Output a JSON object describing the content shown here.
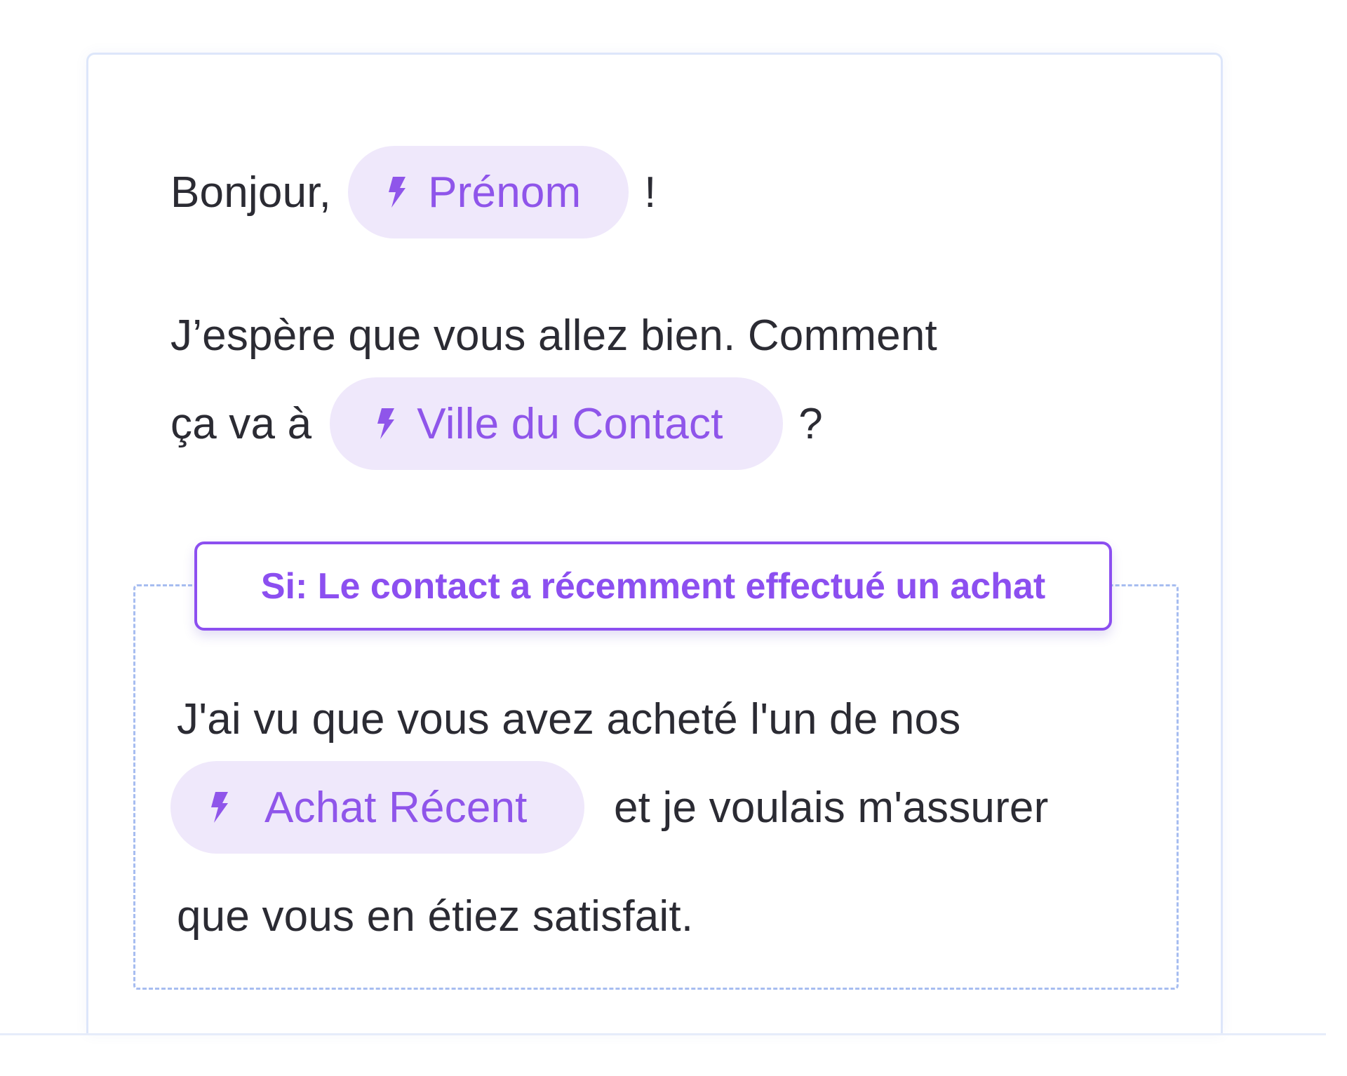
{
  "greeting": {
    "prefix": "Bonjour,",
    "chip_label": "Prénom",
    "suffix": "!"
  },
  "paragraph1": {
    "line1": "J’espère que vous allez bien. Comment",
    "line2_prefix": "ça va à",
    "chip_label": "Ville du Contact",
    "line2_suffix": "?"
  },
  "condition": {
    "label": "Si: Le contact a récemment effectué un achat"
  },
  "conditional_block": {
    "line1": "J'ai vu que vous avez acheté l'un de nos",
    "chip_label": "Achat Récent",
    "line2_suffix": "et je voulais m'assurer",
    "line3": "que vous en étiez satisfait."
  },
  "icons": {
    "variable_icon": "lightning-bolt-icon"
  },
  "colors": {
    "accent": "#8c4ff0",
    "chip_background": "#efe8fb",
    "chip_text": "#8f55ea",
    "body_text": "#2b2b33",
    "card_border": "#dde6fa",
    "dashed_border": "#a7bdf0"
  }
}
